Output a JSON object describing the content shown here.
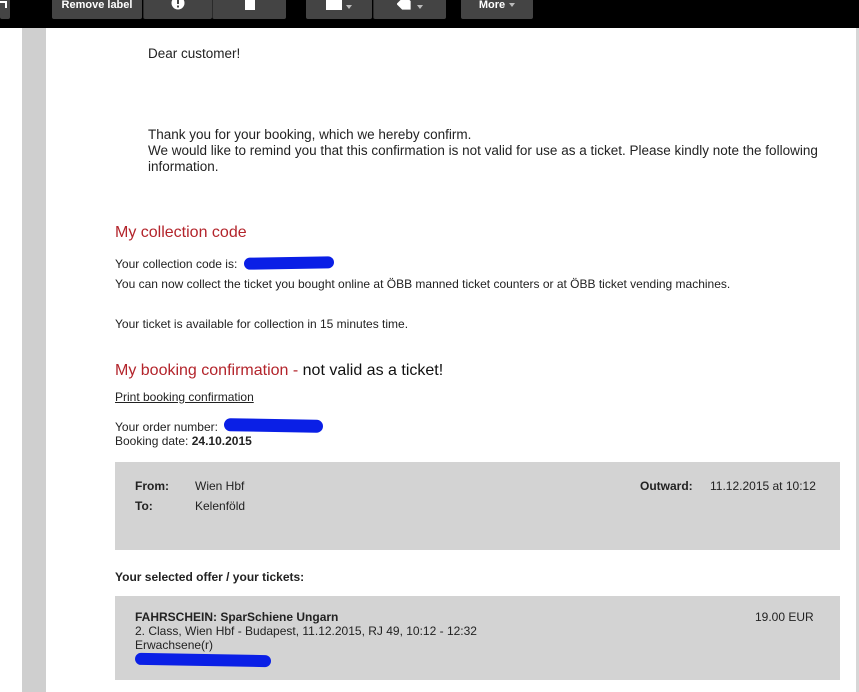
{
  "toolbar": {
    "remove_label": "Remove label",
    "more_label": "More",
    "tab_icon": "tab-icon",
    "spam_icon": "report-spam-icon",
    "delete_icon": "delete-icon",
    "folder_icon": "folder-icon",
    "label_icon": "label-icon",
    "colors": {
      "bar": "#000000",
      "button": "#444444"
    }
  },
  "email": {
    "greeting": "Dear customer!",
    "thanks_line": "Thank you for your booking, which we hereby confirm.",
    "remind_line": "We would like to remind you that this confirmation is not valid for use as a ticket. Please kindly note the following",
    "remind_line_cont": "information.",
    "collection": {
      "heading": "My collection code",
      "code_label": "Your collection code is:",
      "collect_info": "You can now collect the ticket you bought online at ÖBB manned ticket counters or at ÖBB ticket vending machines.",
      "available_info": "Your ticket is available for collection in 15 minutes time."
    },
    "booking": {
      "heading_red": "My booking confirmation - ",
      "heading_black": "not valid as a ticket!",
      "print_link": "Print booking confirmation",
      "order_label": "Your order number:",
      "date_label": "Booking date:",
      "date_value": "24.10.2015"
    },
    "journey": {
      "from_label": "From:",
      "from_value": "Wien Hbf",
      "to_label": "To:",
      "to_value": "Kelenföld",
      "outward_label": "Outward:",
      "outward_value": "11.12.2015 at 10:12"
    },
    "offer": {
      "heading": "Your selected offer / your tickets:",
      "ticket_title": "FAHRSCHEIN: SparSchiene Ungarn",
      "ticket_price": "19.00 EUR",
      "ticket_details": "2. Class, Wien Hbf - Budapest, 11.12.2015, RJ 49, 10:12 - 12:32",
      "passenger_type": "Erwachsene(r)"
    },
    "colors": {
      "heading_red": "#b3242b",
      "panel": "#d3d3d3",
      "redaction": "#0a1fe6"
    }
  }
}
